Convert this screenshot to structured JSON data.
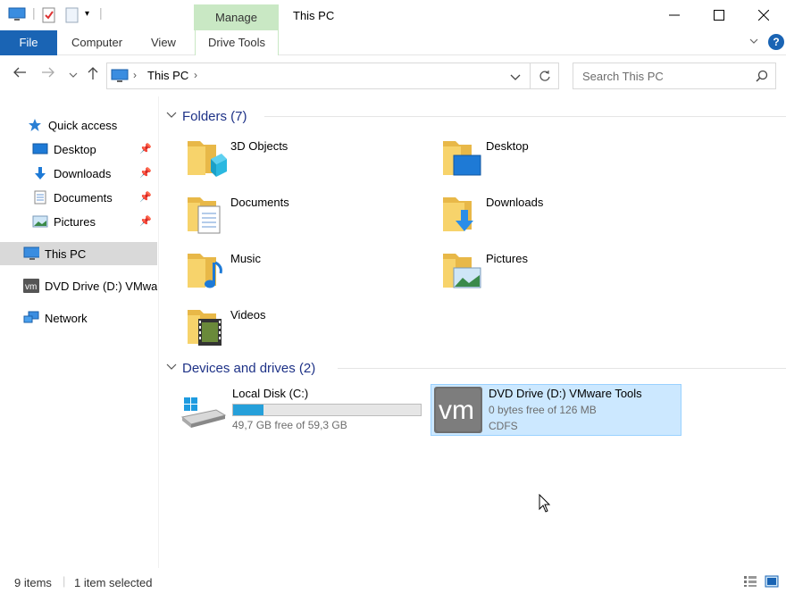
{
  "titlebar": {
    "manage_label": "Manage",
    "title": "This PC",
    "minimize": "—",
    "maximize": "☐",
    "close": "✕"
  },
  "ribbon": {
    "tabs": [
      "File",
      "Computer",
      "View",
      "Drive Tools"
    ],
    "help": "?"
  },
  "address": {
    "segment": "This PC",
    "search_placeholder": "Search This PC"
  },
  "nav": {
    "quick_access": "Quick access",
    "items": [
      {
        "label": "Desktop",
        "pinned": true
      },
      {
        "label": "Downloads",
        "pinned": true
      },
      {
        "label": "Documents",
        "pinned": true
      },
      {
        "label": "Pictures",
        "pinned": true
      }
    ],
    "this_pc": "This PC",
    "dvd": "DVD Drive (D:) VMwa",
    "network": "Network"
  },
  "content": {
    "folders_header": "Folders (7)",
    "folders": [
      "3D Objects",
      "Desktop",
      "Documents",
      "Downloads",
      "Music",
      "Pictures",
      "Videos"
    ],
    "devices_header": "Devices and drives (2)",
    "drives": [
      {
        "name": "Local Disk (C:)",
        "free": "49,7 GB free of 59,3 GB",
        "used_fraction": 0.16
      },
      {
        "name": "DVD Drive (D:) VMware Tools",
        "free": "0 bytes free of 126 MB",
        "fs": "CDFS",
        "logo": "vm"
      }
    ]
  },
  "status": {
    "items": "9 items",
    "selected": "1 item selected"
  },
  "colors": {
    "accent": "#1a64b4",
    "manage_tab": "#c9e8c4",
    "selection": "#cce8ff",
    "header_text": "#1e3287",
    "disk_bar": "#26a0da"
  }
}
